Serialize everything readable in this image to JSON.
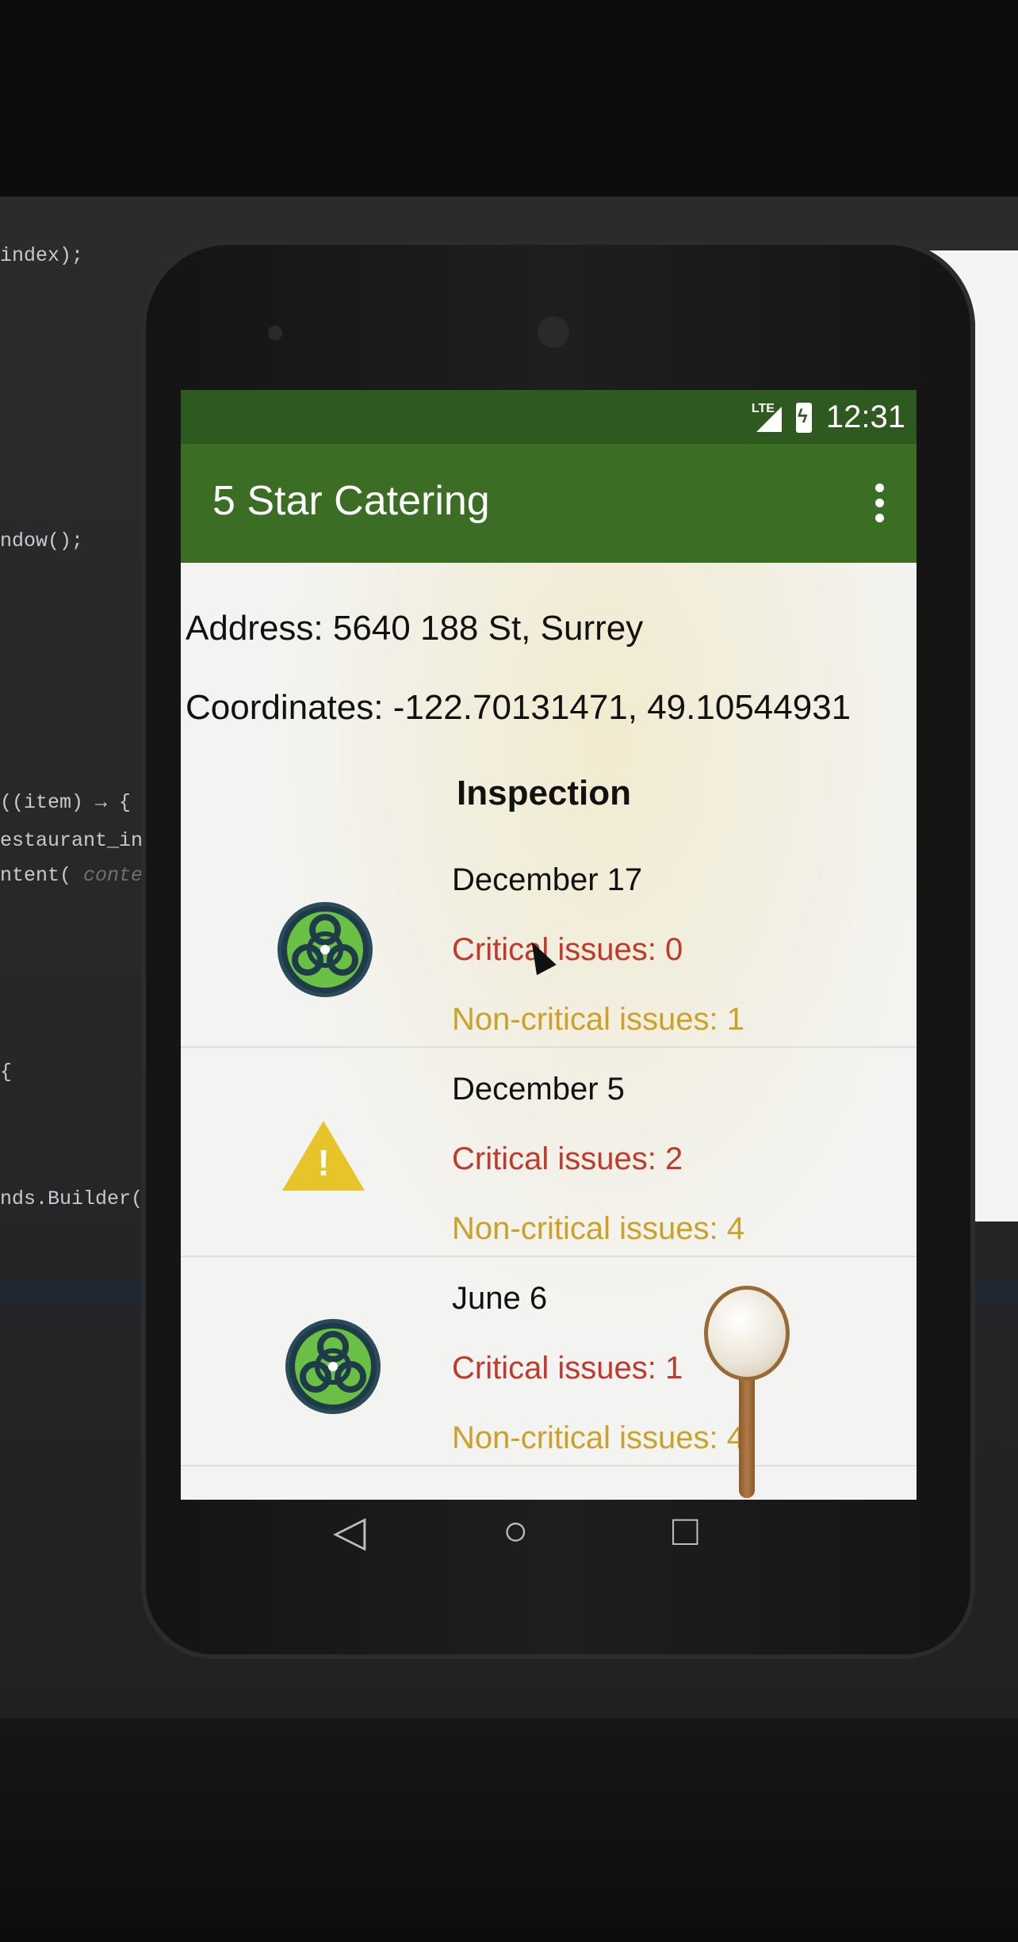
{
  "ide": {
    "lines": [
      "index);",
      "ndow();",
      "((item) → {",
      "estaurant_ind",
      "ntent( ",
      "{",
      "nds.Builder();"
    ],
    "context_hint": "context"
  },
  "status_bar": {
    "network": "LTE",
    "time": "12:31"
  },
  "app_bar": {
    "title": "5 Star Catering",
    "overflow_icon": "more-vert-icon"
  },
  "details": {
    "address": "Address: 5640 188 St, Surrey",
    "coordinates": "Coordinates: -122.70131471,  49.10544931"
  },
  "inspection": {
    "heading": "Inspection",
    "items": [
      {
        "date": "December 17",
        "critical": "Critical issues: 0",
        "non_critical": "Non-critical issues: 1",
        "hazard_icon": "biohazard-icon"
      },
      {
        "date": "December 5",
        "critical": "Critical issues: 2",
        "non_critical": "Non-critical issues: 4",
        "hazard_icon": "warning-icon"
      },
      {
        "date": "June 6",
        "critical": "Critical issues: 1",
        "non_critical": "Non-critical issues: 4",
        "hazard_icon": "biohazard-icon"
      }
    ]
  },
  "nav_bar": {
    "back": "◁",
    "home": "○",
    "recents": "□"
  },
  "emulator_toolbar": {
    "tools": [
      "rotate-left-icon",
      "rotate-right-icon",
      "camera-icon",
      "zoom-icon",
      "back-icon",
      "home-icon",
      "overview-icon",
      "more-icon"
    ],
    "more_label": "···"
  },
  "colors": {
    "status_bar": "#2f5a1f",
    "app_bar": "#3b6d25",
    "critical": "#c0392b",
    "non_critical": "#c9a227"
  }
}
